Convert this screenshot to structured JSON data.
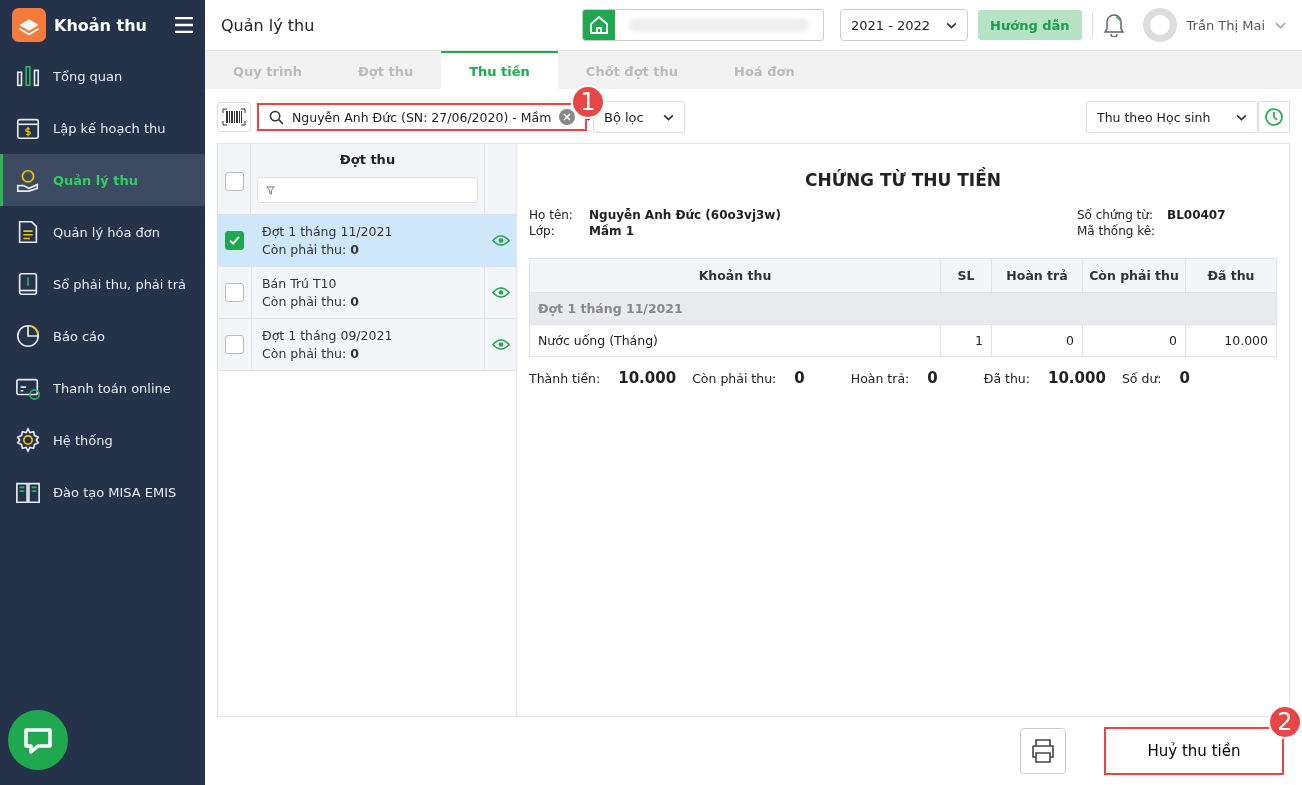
{
  "app": {
    "title": "Khoản thu"
  },
  "sidebar": {
    "items": [
      {
        "label": "Tổng quan",
        "kind": "chart",
        "selected": false
      },
      {
        "label": "Lập kế hoạch thu",
        "kind": "calendar",
        "selected": false
      },
      {
        "label": "Quản lý thu",
        "kind": "money",
        "selected": true
      },
      {
        "label": "Quản lý hóa đơn",
        "kind": "document",
        "selected": false
      },
      {
        "label": "Sổ phải thu, phải trả",
        "kind": "ledger",
        "selected": false
      },
      {
        "label": "Báo cáo",
        "kind": "pie",
        "selected": false
      },
      {
        "label": "Thanh toán online",
        "kind": "card",
        "selected": false
      },
      {
        "label": "Hệ thống",
        "kind": "gear",
        "selected": false
      },
      {
        "label": "Đào tạo MISA EMIS",
        "kind": "book",
        "selected": false
      }
    ]
  },
  "header": {
    "title": "Quản lý thu",
    "year": "2021 - 2022",
    "help_button": "Hướng dẫn",
    "user": "Trần Thị Mai"
  },
  "tabs": [
    {
      "label": "Quy trình",
      "selected": false
    },
    {
      "label": "Đợt thu",
      "selected": false
    },
    {
      "label": "Thu tiền",
      "selected": true
    },
    {
      "label": "Chốt đợt thu",
      "selected": false
    },
    {
      "label": "Hoá đơn",
      "selected": false
    }
  ],
  "toolbar": {
    "search_value": "Nguyễn Anh Đức (SN: 27/06/2020) - Mầm",
    "filter": "Bộ lọc",
    "mode": "Thu theo Học sinh"
  },
  "batches": {
    "column": "Đợt thu",
    "all_checked": false,
    "rows": [
      {
        "name": "Đợt 1 tháng 11/2021",
        "due": "Còn phải thu: **0**",
        "checked": true,
        "selected": true
      },
      {
        "name": "Bán Trú T10",
        "due": "Còn phải thu: **0**",
        "checked": false,
        "selected": false
      },
      {
        "name": "Đợt 1 tháng 09/2021",
        "due": "Còn phải thu: **0**",
        "checked": false,
        "selected": false
      }
    ]
  },
  "receipt": {
    "title": "CHỨNG TỪ THU TIỀN",
    "left_fields": [
      {
        "label": "Họ tên:",
        "value": "Nguyễn Anh Đức (60o3vj3w)"
      },
      {
        "label": "Lớp:",
        "value": "Mầm 1"
      }
    ],
    "right_fields": [
      {
        "label": "Số chứng từ:",
        "value": "BL00407"
      },
      {
        "label": "Mã thống kê:"
      }
    ],
    "columns": [
      "Khoản thu",
      "SL",
      "Hoàn trả",
      "Còn phải thu",
      "Đã thu"
    ],
    "group": "Đợt 1 tháng 11/2021",
    "rows": [
      [
        "Nước uống (Tháng)",
        "1",
        "0",
        "0",
        "10.000"
      ]
    ],
    "totals": [
      {
        "label": "Thành tiền:",
        "value": "10.000"
      },
      {
        "label": "Còn phải thu:",
        "value": "0"
      },
      {
        "label": "Hoàn trả:",
        "value": "0"
      },
      {
        "label": "Đã thu:",
        "value": "10.000"
      },
      {
        "label": "Số dư:",
        "value": "0"
      }
    ]
  },
  "footer": {
    "cancel_button": "Huỷ thu tiền"
  },
  "callouts": [
    "1",
    "2"
  ]
}
